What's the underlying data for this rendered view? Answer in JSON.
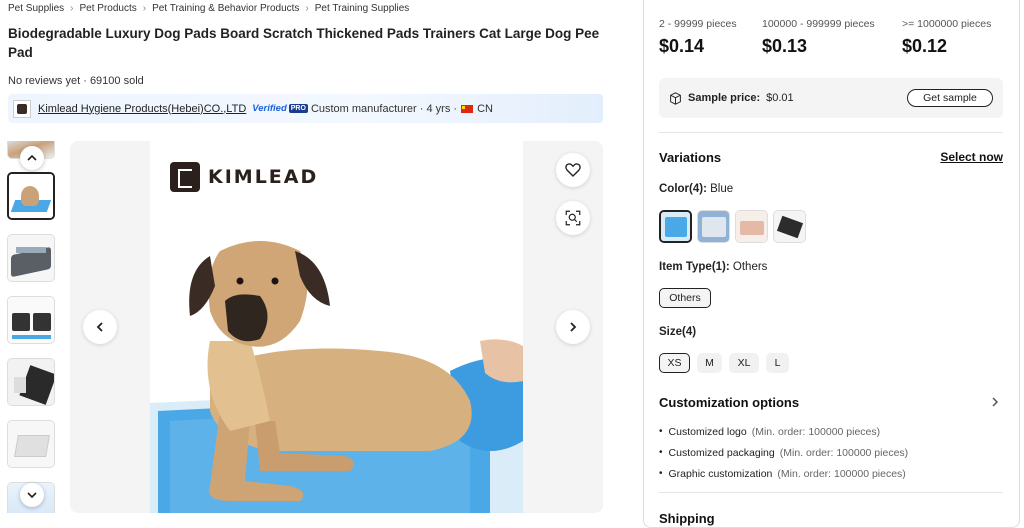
{
  "breadcrumb": [
    "Pet Supplies",
    "Pet Products",
    "Pet Training & Behavior Products",
    "Pet Training Supplies"
  ],
  "product": {
    "title": "Biodegradable Luxury Dog Pads Board Scratch Thickened Pads Trainers Cat Large Dog Pee Pad",
    "reviews": "No reviews yet",
    "sold": "69100 sold"
  },
  "supplier": {
    "name": "Kimlead Hygiene Products(Hebei)CO.,LTD",
    "verified": "Verified",
    "pro": "PRO",
    "type": "Custom manufacturer",
    "years": "4 yrs",
    "country": "CN"
  },
  "gallery": {
    "brand_text": "KIMLEAD",
    "icons": {
      "favorite": "heart-icon",
      "visual_search": "image-search-icon",
      "prev": "chevron-left-icon",
      "next": "chevron-right-icon"
    }
  },
  "pricing": {
    "tiers": [
      {
        "range": "2 - 99999 pieces",
        "price": "$0.14"
      },
      {
        "range": "100000 - 999999 pieces",
        "price": "$0.13"
      },
      {
        "range": ">= 1000000 pieces",
        "price": "$0.12"
      }
    ],
    "sample_label": "Sample price:",
    "sample_value": "$0.01",
    "sample_button": "Get sample"
  },
  "variations": {
    "title": "Variations",
    "select_now": "Select now",
    "color_label": "Color(4):",
    "color_selected": "Blue",
    "item_type_label": "Item Type(1):",
    "item_type_selected": "Others",
    "item_types": [
      "Others"
    ],
    "size_label": "Size(4)",
    "sizes": [
      "XS",
      "M",
      "XL",
      "L"
    ]
  },
  "customization": {
    "title": "Customization options",
    "options": [
      {
        "name": "Customized logo",
        "min": "(Min. order: 100000 pieces)"
      },
      {
        "name": "Customized packaging",
        "min": "(Min. order: 100000 pieces)"
      },
      {
        "name": "Graphic customization",
        "min": "(Min. order: 100000 pieces)"
      }
    ]
  },
  "shipping": {
    "title": "Shipping"
  },
  "colors": {
    "pad_blue": "#4aa8e6",
    "accent": "#1a62d8"
  }
}
